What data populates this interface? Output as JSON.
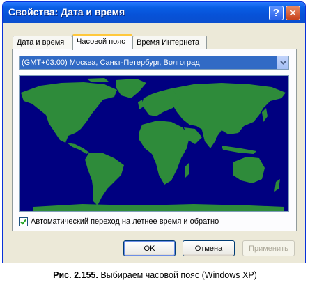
{
  "window": {
    "title": "Свойства: Дата и время",
    "help_glyph": "?",
    "close_glyph": "✕"
  },
  "tabs": [
    {
      "label": "Дата и время",
      "active": false
    },
    {
      "label": "Часовой пояс",
      "active": true
    },
    {
      "label": "Время Интернета",
      "active": false
    }
  ],
  "timezone": {
    "selected": "(GMT+03:00) Москва, Санкт-Петербург, Волгоград"
  },
  "map": {
    "ocean_color": "#000080",
    "land_color": "#2e8b3a"
  },
  "dst": {
    "checked": true,
    "label": "Автоматический переход на летнее время и обратно"
  },
  "buttons": {
    "ok": "OK",
    "cancel": "Отмена",
    "apply": "Применить"
  },
  "caption": {
    "number": "Рис. 2.155.",
    "text": "Выбираем часовой пояс (Windows XP)"
  }
}
